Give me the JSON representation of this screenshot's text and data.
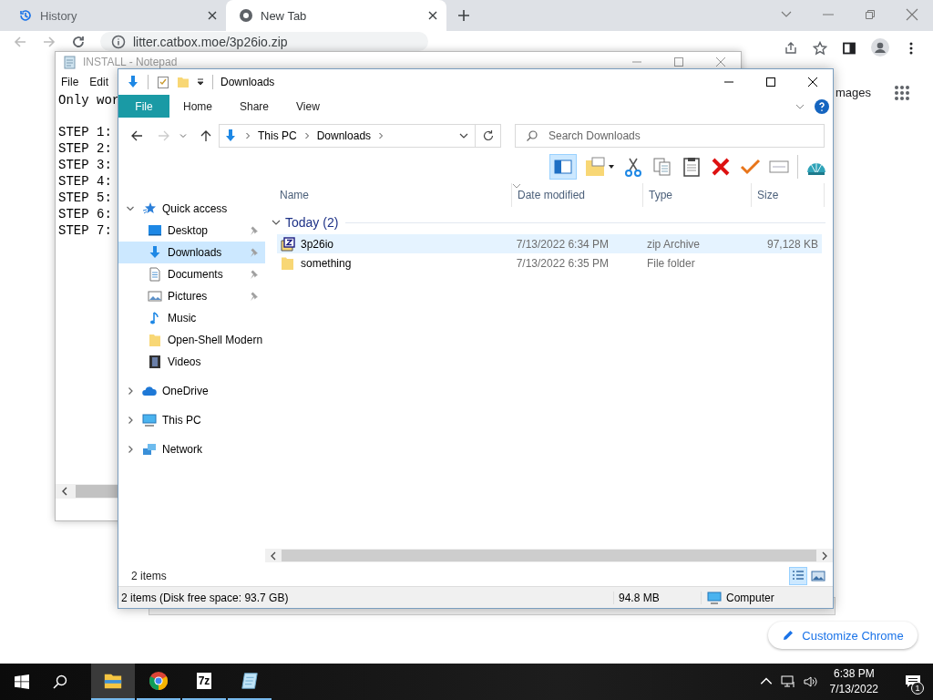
{
  "browser": {
    "tabs": [
      {
        "title": "History",
        "selected": false
      },
      {
        "title": "New Tab",
        "selected": true
      }
    ],
    "address": "litter.catbox.moe/3p26io.zip",
    "page": {
      "link": "mages",
      "customize_button": "Customize Chrome"
    }
  },
  "notepad": {
    "title": "INSTALL - Notepad",
    "menu": [
      "File",
      "Edit"
    ],
    "first_line": "Only wor",
    "steps": [
      "STEP 1:",
      "STEP 2:",
      "STEP 3:",
      "STEP 4:",
      "STEP 5:",
      "STEP 6:",
      "STEP 7:"
    ]
  },
  "explorer": {
    "title": "Downloads",
    "ribbon_tabs": [
      {
        "label": "File",
        "kind": "file"
      },
      {
        "label": "Home",
        "kind": "tab"
      },
      {
        "label": "Share",
        "kind": "tab"
      },
      {
        "label": "View",
        "kind": "tab"
      }
    ],
    "breadcrumb": [
      "This PC",
      "Downloads"
    ],
    "search": {
      "placeholder": "Search Downloads"
    },
    "nav": [
      {
        "label": "Quick access",
        "expanded": true,
        "selected": false,
        "children": [
          {
            "label": "Desktop",
            "pinned": true,
            "selected": false
          },
          {
            "label": "Downloads",
            "pinned": true,
            "selected": true
          },
          {
            "label": "Documents",
            "pinned": true,
            "selected": false
          },
          {
            "label": "Pictures",
            "pinned": true,
            "selected": false
          },
          {
            "label": "Music",
            "pinned": false,
            "selected": false
          },
          {
            "label": "Open-Shell Modern",
            "pinned": false,
            "selected": false
          },
          {
            "label": "Videos",
            "pinned": false,
            "selected": false
          }
        ]
      },
      {
        "label": "OneDrive",
        "expanded": false,
        "selected": false
      },
      {
        "label": "This PC",
        "expanded": false,
        "selected": false
      },
      {
        "label": "Network",
        "expanded": false,
        "selected": false
      }
    ],
    "columns": [
      "Name",
      "Date modified",
      "Type",
      "Size"
    ],
    "group": {
      "label": "Today (2)",
      "expanded": true
    },
    "files": [
      {
        "name": "3p26io",
        "kind": "zip",
        "date": "7/13/2022 6:34 PM",
        "type": "zip Archive",
        "size": "97,128 KB",
        "selected": true
      },
      {
        "name": "something",
        "kind": "folder",
        "date": "7/13/2022 6:35 PM",
        "type": "File folder",
        "selected": false
      }
    ],
    "item_count": "2 items",
    "view_buttons": [
      {
        "kind": "details",
        "selected": true
      },
      {
        "kind": "tiles",
        "selected": false
      }
    ],
    "status": {
      "text": "2 items (Disk free space: 93.7 GB)",
      "size": "94.8 MB",
      "location": "Computer"
    }
  },
  "taskbar": {
    "apps": [
      {
        "kind": "explorer",
        "selected": true
      },
      {
        "kind": "chrome",
        "selected": false
      },
      {
        "kind": "sevenzip",
        "label": "7z",
        "selected": false
      },
      {
        "kind": "notepad",
        "selected": false
      }
    ],
    "time": "6:38 PM",
    "date": "7/13/2022",
    "notifications": "1"
  }
}
